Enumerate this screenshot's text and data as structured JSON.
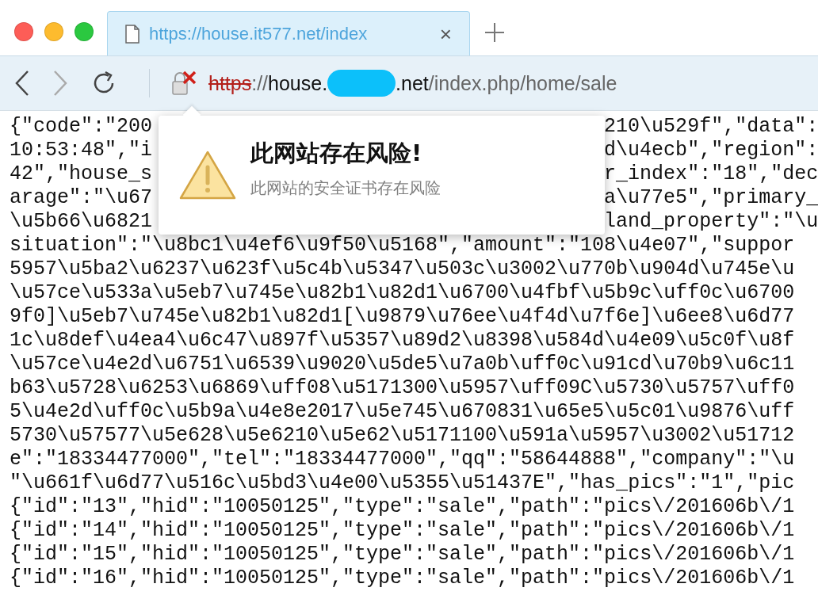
{
  "tab": {
    "title": "https://house.it577.net/index",
    "selected": true,
    "close": "×"
  },
  "address_bar": {
    "secure": false,
    "scheme": "https",
    "host_start": "://house.",
    "host_end": ".net",
    "path": "/index.php/home/sale"
  },
  "security_popup": {
    "title": "此网站存在风险!",
    "message": "此网站的安全证书存在风险"
  },
  "page_lines": [
    {
      "left": "{\"code\":\"200",
      "right": "210\\u529f\",\"data\":"
    },
    {
      "left": "10:53:48\",\"i",
      "right": "d\\u4ecb\",\"region\":"
    },
    {
      "left": "42\",\"house_s",
      "right": "r_index\":\"18\",\"dec"
    },
    {
      "left": "arage\":\"\\u67",
      "right": "a\\u77e5\",\"primary_"
    },
    {
      "left": "\\u5b66\\u6821",
      "right": "land_property\":\"\\u"
    },
    {
      "left": "situation\":\"\\u8bc1\\u4ef6\\u9f50\\u5168\",\"amount\":\"108\\u4e07\",\"suppor"
    },
    {
      "left": "5957\\u5ba2\\u6237\\u623f\\u5c4b\\u5347\\u503c\\u3002\\u770b\\u904d\\u745e\\u"
    },
    {
      "left": "\\u57ce\\u533a\\u5eb7\\u745e\\u82b1\\u82d1\\u6700\\u4fbf\\u5b9c\\uff0c\\u6700"
    },
    {
      "left": "9f0]\\u5eb7\\u745e\\u82b1\\u82d1[\\u9879\\u76ee\\u4f4d\\u7f6e]\\u6ee8\\u6d77"
    },
    {
      "left": "1c\\u8def\\u4ea4\\u6c47\\u897f\\u5357\\u89d2\\u8398\\u584d\\u4e09\\u5c0f\\u8f"
    },
    {
      "left": "\\u57ce\\u4e2d\\u6751\\u6539\\u9020\\u5de5\\u7a0b\\uff0c\\u91cd\\u70b9\\u6c11"
    },
    {
      "left": "b63\\u5728\\u6253\\u6869\\uff08\\u5171300\\u5957\\uff09C\\u5730\\u5757\\uff0"
    },
    {
      "left": "5\\u4e2d\\uff0c\\u5b9a\\u4e8e2017\\u5e745\\u670831\\u65e5\\u5c01\\u9876\\uff"
    },
    {
      "left": "5730\\u57577\\u5e628\\u5e6210\\u5e62\\u5171100\\u591a\\u5957\\u3002\\u51712"
    },
    {
      "left": "e\":\"18334477000\",\"tel\":\"18334477000\",\"qq\":\"58644888\",\"company\":\"\\u"
    },
    {
      "left": "\"\\u661f\\u6d77\\u516c\\u5bd3\\u4e00\\u5355\\u51437E\",\"has_pics\":\"1\",\"pic"
    },
    {
      "left": "{\"id\":\"13\",\"hid\":\"10050125\",\"type\":\"sale\",\"path\":\"pics\\/201606b\\/1"
    },
    {
      "left": "{\"id\":\"14\",\"hid\":\"10050125\",\"type\":\"sale\",\"path\":\"pics\\/201606b\\/1"
    },
    {
      "left": "{\"id\":\"15\",\"hid\":\"10050125\",\"type\":\"sale\",\"path\":\"pics\\/201606b\\/1"
    },
    {
      "left": "{\"id\":\"16\",\"hid\":\"10050125\",\"type\":\"sale\",\"path\":\"pics\\/201606b\\/1"
    }
  ]
}
